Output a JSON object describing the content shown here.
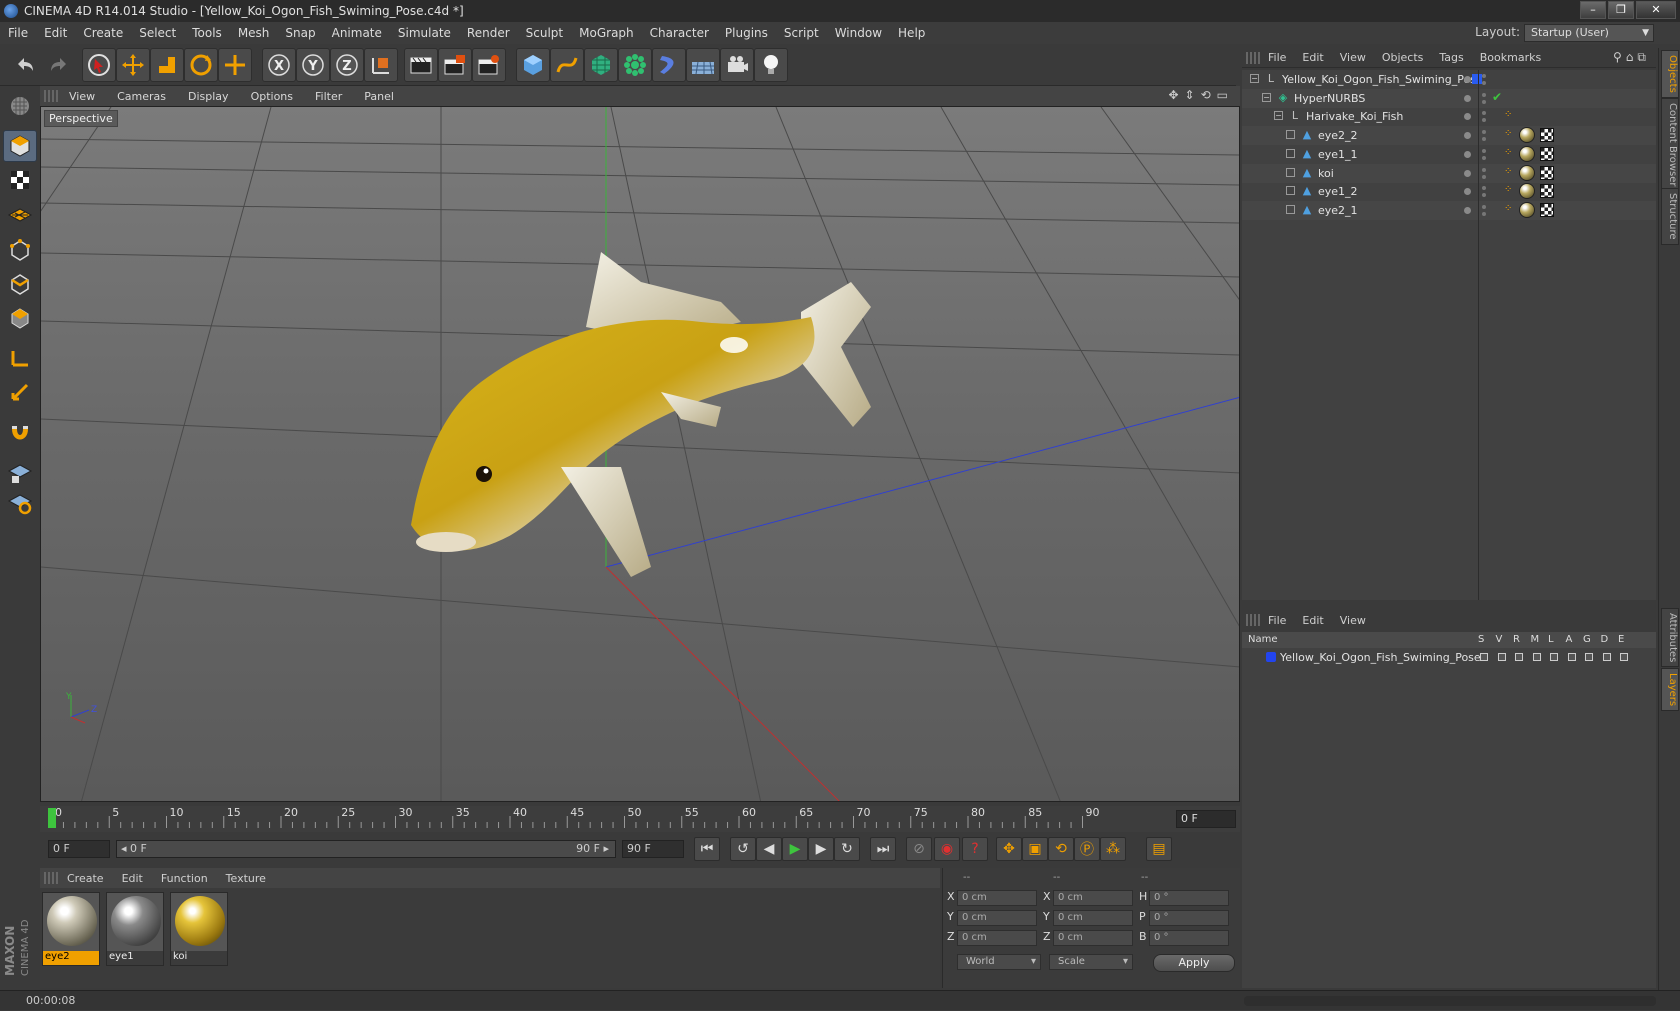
{
  "window": {
    "title": "CINEMA 4D R14.014 Studio - [Yellow_Koi_Ogon_Fish_Swiming_Pose.c4d *]",
    "controls": [
      "–",
      "❐",
      "✕"
    ]
  },
  "menubar": {
    "items": [
      "File",
      "Edit",
      "Create",
      "Select",
      "Tools",
      "Mesh",
      "Snap",
      "Animate",
      "Simulate",
      "Render",
      "Sculpt",
      "MoGraph",
      "Character",
      "Plugins",
      "Script",
      "Window",
      "Help"
    ],
    "layout_label": "Layout:",
    "layout_value": "Startup (User)"
  },
  "toolbar": {
    "icons": [
      "undo-icon",
      "redo-icon",
      "live-selection-icon",
      "move-icon",
      "scale-icon",
      "rotate-icon",
      "recent-tools-icon",
      "x-axis-icon",
      "y-axis-icon",
      "z-axis-icon",
      "coordinate-system-icon",
      "render-view-icon",
      "render-picture-viewer-icon",
      "render-settings-icon",
      "cube-primitive-icon",
      "spline-pen-icon",
      "subdivision-surface-icon",
      "array-icon",
      "deformer-icon",
      "floor-icon",
      "camera-icon",
      "light-icon"
    ],
    "axis_labels": [
      "X",
      "Y",
      "Z"
    ]
  },
  "left_tools": [
    "make-editable-icon",
    "model-mode-icon",
    "texture-mode-icon",
    "workplane-mode-icon",
    "points-mode-icon",
    "edges-mode-icon",
    "polygons-mode-icon",
    "axis-mode-icon",
    "tweak-mode-icon",
    "snap-icon",
    "workplane-lock-icon",
    "snap-settings-icon"
  ],
  "brand": {
    "line1": "MAXON",
    "line2": "CINEMA 4D"
  },
  "viewport": {
    "menu": [
      "View",
      "Cameras",
      "Display",
      "Options",
      "Filter",
      "Panel"
    ],
    "label": "Perspective",
    "nav_icons": [
      "✥",
      "⇕",
      "⟲",
      "▭"
    ],
    "axis_labels": {
      "y": "Y",
      "z": "Z"
    }
  },
  "timeline": {
    "ticks": [
      "0",
      "5",
      "10",
      "15",
      "20",
      "25",
      "30",
      "35",
      "40",
      "45",
      "50",
      "55",
      "60",
      "65",
      "70",
      "75",
      "80",
      "85",
      "90"
    ],
    "current_frame": "0 F"
  },
  "transport": {
    "start_field": "0 F",
    "range_start": "◂ 0 F",
    "range_end": "90 F ▸",
    "end_field": "90 F",
    "buttons": [
      "goto-start-icon",
      "prev-key-icon",
      "prev-frame-icon",
      "play-icon",
      "next-frame-icon",
      "next-key-icon",
      "goto-end-icon"
    ],
    "record_buttons": [
      "motion-record-icon",
      "record-icon",
      "autokey-icon"
    ],
    "key_buttons": [
      "key-position-icon",
      "key-scale-icon",
      "key-rotation-icon",
      "key-parameter-icon",
      "key-pla-icon",
      "timeline-icon"
    ]
  },
  "materials": {
    "menu": [
      "Create",
      "Edit",
      "Function",
      "Texture"
    ],
    "items": [
      {
        "name": "eye2",
        "selected": true
      },
      {
        "name": "eye1",
        "selected": false
      },
      {
        "name": "koi",
        "selected": false
      }
    ]
  },
  "coords": {
    "col_headers": [
      "--",
      "--",
      "--"
    ],
    "rows": [
      {
        "a": "X",
        "a_val": "0 cm",
        "b": "X",
        "b_val": "0 cm",
        "c": "H",
        "c_val": "0 °"
      },
      {
        "a": "Y",
        "a_val": "0 cm",
        "b": "Y",
        "b_val": "0 cm",
        "c": "P",
        "c_val": "0 °"
      },
      {
        "a": "Z",
        "a_val": "0 cm",
        "b": "Z",
        "b_val": "0 cm",
        "c": "B",
        "c_val": "0 °"
      }
    ],
    "mode_select": "World",
    "size_select": "Scale",
    "apply_label": "Apply"
  },
  "status": {
    "text": "00:00:08"
  },
  "objects": {
    "menu": [
      "File",
      "Edit",
      "View",
      "Objects",
      "Tags",
      "Bookmarks"
    ],
    "tree": [
      {
        "name": "Yellow_Koi_Ogon_Fish_Swiming_Pose",
        "indent": 0,
        "icon": "null-object-icon",
        "tags": "layer"
      },
      {
        "name": "HyperNURBS",
        "indent": 1,
        "icon": "hypernurbs-icon",
        "tags": "check"
      },
      {
        "name": "Harivake_Koi_Fish",
        "indent": 2,
        "icon": "null-object-icon",
        "tags": "none"
      },
      {
        "name": "eye2_2",
        "indent": 3,
        "icon": "polygon-object-icon",
        "tags": "mat"
      },
      {
        "name": "eye1_1",
        "indent": 3,
        "icon": "polygon-object-icon",
        "tags": "mat"
      },
      {
        "name": "koi",
        "indent": 3,
        "icon": "polygon-object-icon",
        "tags": "mat"
      },
      {
        "name": "eye1_2",
        "indent": 3,
        "icon": "polygon-object-icon",
        "tags": "mat"
      },
      {
        "name": "eye2_1",
        "indent": 3,
        "icon": "polygon-object-icon",
        "tags": "mat"
      }
    ]
  },
  "layers": {
    "menu": [
      "File",
      "Edit",
      "View"
    ],
    "header_name": "Name",
    "header_cols": [
      "S",
      "V",
      "R",
      "M",
      "L",
      "A",
      "G",
      "D",
      "E"
    ],
    "rows": [
      {
        "name": "Yellow_Koi_Ogon_Fish_Swiming_Pose",
        "color": "#2244ee"
      }
    ]
  },
  "side_tabs": [
    "Objects",
    "Content Browser",
    "Structure",
    "Attributes",
    "Layers"
  ],
  "colors": {
    "accent": "#f0a000",
    "selection": "#5b6b80",
    "layer": "#2244ee"
  }
}
